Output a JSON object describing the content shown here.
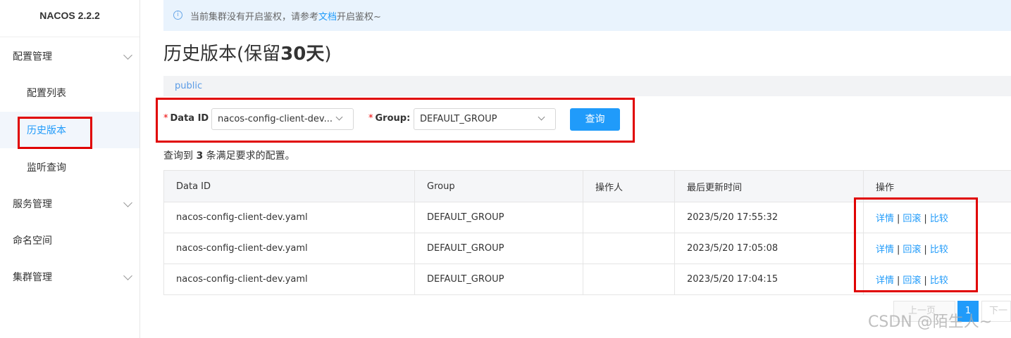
{
  "brand": "NACOS 2.2.2",
  "sidebar": {
    "items": [
      {
        "label": "配置管理",
        "expandable": true
      },
      {
        "label": "配置列表"
      },
      {
        "label": "历史版本",
        "active": true
      },
      {
        "label": "监听查询"
      },
      {
        "label": "服务管理",
        "expandable": true
      },
      {
        "label": "命名空间"
      },
      {
        "label": "集群管理",
        "expandable": true
      }
    ]
  },
  "notice": {
    "icon": "info-icon",
    "prefix": "当前集群没有开启鉴权，请参考",
    "link": "文档",
    "suffix": "开启鉴权~"
  },
  "page": {
    "title_prefix": "历史版本(保留",
    "title_bold": "30天",
    "title_suffix": ")"
  },
  "namespace": "public",
  "form": {
    "data_id_label": "Data ID",
    "data_id_value": "nacos-config-client-dev...",
    "group_label": "Group:",
    "group_value": "DEFAULT_GROUP",
    "query_button": "查询"
  },
  "result": {
    "prefix": "查询到",
    "count": "3",
    "suffix": "条满足要求的配置。"
  },
  "table": {
    "headers": [
      "Data ID",
      "Group",
      "操作人",
      "最后更新时间",
      "操作"
    ],
    "rows": [
      {
        "data_id": "nacos-config-client-dev.yaml",
        "group": "DEFAULT_GROUP",
        "operator": "",
        "time": "2023/5/20 17:55:32"
      },
      {
        "data_id": "nacos-config-client-dev.yaml",
        "group": "DEFAULT_GROUP",
        "operator": "",
        "time": "2023/5/20 17:05:08"
      },
      {
        "data_id": "nacos-config-client-dev.yaml",
        "group": "DEFAULT_GROUP",
        "operator": "",
        "time": "2023/5/20 17:04:15"
      }
    ],
    "actions": {
      "detail": "详情",
      "rollback": "回滚",
      "compare": "比较"
    }
  },
  "pager": {
    "prev": "上一页",
    "current": "1",
    "next": "下一"
  },
  "watermark": "CSDN @陌生人~",
  "colors": {
    "accent": "#209bfa",
    "highlight_box": "#e00000"
  }
}
